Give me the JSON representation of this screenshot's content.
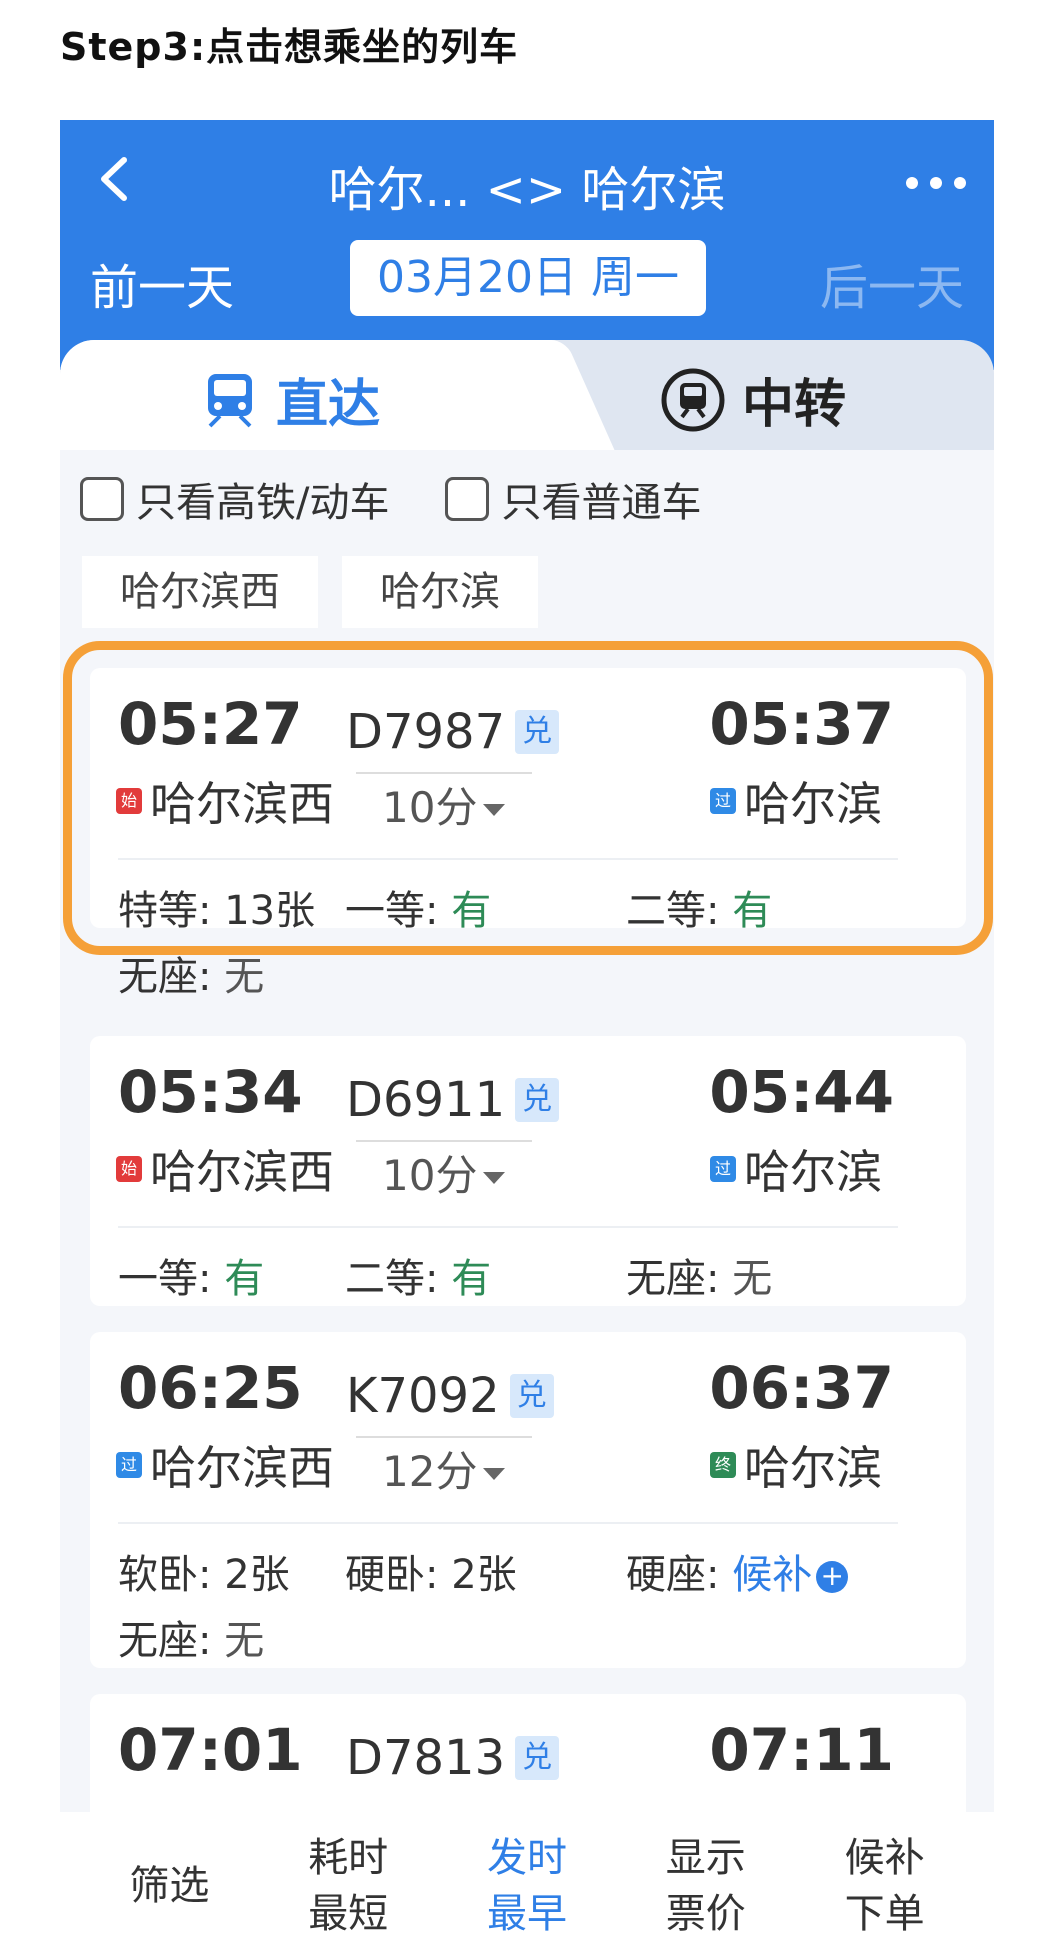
{
  "step_title": "Step3:点击想乘坐的列车",
  "header": {
    "title": "哈尔... <> 哈尔滨",
    "prev_day": "前一天",
    "date": "03月20日 周一",
    "next_day": "后一天"
  },
  "tabs": [
    {
      "label": "直达",
      "icon": "train-icon",
      "active": true
    },
    {
      "label": "中转",
      "icon": "transfer-train-icon",
      "active": false
    }
  ],
  "filters": [
    {
      "label": "只看高铁/动车",
      "checked": false
    },
    {
      "label": "只看普通车",
      "checked": false
    }
  ],
  "station_chips": [
    "哈尔滨西",
    "哈尔滨"
  ],
  "trains": [
    {
      "dep_time": "05:27",
      "dep_badge": "始",
      "dep_station": "哈尔滨西",
      "train_no": "D7987",
      "exchange_badge": "兑",
      "duration": "10分",
      "arr_time": "05:37",
      "arr_badge": "过",
      "arr_station": "哈尔滨",
      "seats": [
        {
          "label": "特等:",
          "value": "13张"
        },
        {
          "label": "一等:",
          "value": "有"
        },
        {
          "label": "二等:",
          "value": "有"
        },
        {
          "label": "无座:",
          "value": "无"
        }
      ],
      "highlighted": true
    },
    {
      "dep_time": "05:34",
      "dep_badge": "始",
      "dep_station": "哈尔滨西",
      "train_no": "D6911",
      "exchange_badge": "兑",
      "duration": "10分",
      "arr_time": "05:44",
      "arr_badge": "过",
      "arr_station": "哈尔滨",
      "seats": [
        {
          "label": "一等:",
          "value": "有"
        },
        {
          "label": "二等:",
          "value": "有"
        },
        {
          "label": "无座:",
          "value": "无"
        }
      ]
    },
    {
      "dep_time": "06:25",
      "dep_badge": "过",
      "dep_station": "哈尔滨西",
      "train_no": "K7092",
      "exchange_badge": "兑",
      "duration": "12分",
      "arr_time": "06:37",
      "arr_badge": "终",
      "arr_station": "哈尔滨",
      "seats": [
        {
          "label": "软卧:",
          "value": "2张"
        },
        {
          "label": "硬卧:",
          "value": "2张"
        },
        {
          "label": "硬座:",
          "value": "候补"
        },
        {
          "label": "无座:",
          "value": "无"
        }
      ]
    },
    {
      "dep_time": "07:01",
      "train_no": "D7813",
      "exchange_badge": "兑",
      "arr_time": "07:11"
    }
  ],
  "bottom_bar": [
    {
      "line1": "筛选",
      "line2": ""
    },
    {
      "line1": "耗时",
      "line2": "最短"
    },
    {
      "line1": "发时",
      "line2": "最早",
      "active": true
    },
    {
      "line1": "显示",
      "line2": "票价"
    },
    {
      "line1": "候补",
      "line2": "下单"
    }
  ],
  "colors": {
    "primary": "#2f7fe6",
    "highlight": "#f5a038",
    "available": "#2e8b57"
  }
}
